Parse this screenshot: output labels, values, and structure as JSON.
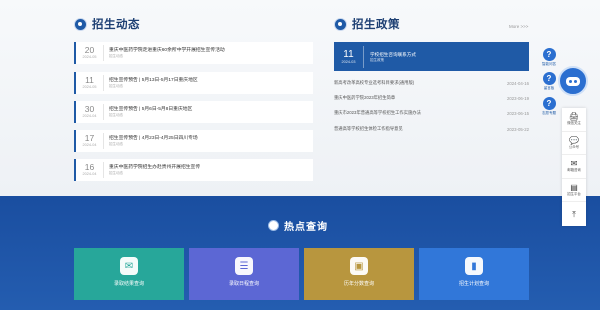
{
  "admissions_news": {
    "title": "招生动态",
    "items": [
      {
        "day": "20",
        "ym": "2024-05",
        "title": "重庆中医药学院走进重庆60余所中学开展招生宣传活动",
        "source": "招生动态"
      },
      {
        "day": "11",
        "ym": "2024-05",
        "title": "招生宣传预告 | 5月13日-5月17日重庆地区",
        "source": "招生动态"
      },
      {
        "day": "30",
        "ym": "2024-04",
        "title": "招生宣传预告 | 5月6日-5月8日重庆地区",
        "source": "招生动态"
      },
      {
        "day": "17",
        "ym": "2024-04",
        "title": "招生宣传预告 | 4月23日-4月25日四川专场",
        "source": "招生动态"
      },
      {
        "day": "16",
        "ym": "2024-04",
        "title": "重庆中医药学院招生办赴贵州开展招生宣传",
        "source": "招生动态"
      }
    ]
  },
  "admissions_policy": {
    "title": "招生政策",
    "more": "More >>>",
    "featured": {
      "day": "11",
      "ym": "2024-03",
      "title": "学校招生咨询联系方式",
      "source": "招生政策"
    },
    "items": [
      {
        "title": "新高考改革高校专业选考科目要求(通用版)",
        "date": "2024-04-16"
      },
      {
        "title": "重庆中医药学院2023年招生简章",
        "date": "2023-06-19"
      },
      {
        "title": "重庆市2023年普通高等学校招生工作实施办法",
        "date": "2023-06-15"
      },
      {
        "title": "普通高等学校招生体检工作指导意见",
        "date": "2023-05-22"
      }
    ]
  },
  "hot_query": {
    "title": "热点查询",
    "cards": [
      {
        "label": "录取结果查询",
        "icon": "envelope-icon",
        "color": "#27a79a"
      },
      {
        "label": "录取日程查询",
        "icon": "list-icon",
        "color": "#5c67d4"
      },
      {
        "label": "历年分数查询",
        "icon": "folder-icon",
        "color": "#b8963e"
      },
      {
        "label": "招生计划查询",
        "icon": "bookmark-icon",
        "color": "#3177d9"
      }
    ]
  },
  "quick_links": [
    {
      "glyph": "?",
      "label": "智能问答"
    },
    {
      "glyph": "?",
      "label": "留言板"
    },
    {
      "glyph": "?",
      "label": "志愿专题"
    }
  ],
  "side_rail": [
    {
      "glyph": "🖨",
      "label": "微信关注",
      "icon": "printer-icon"
    },
    {
      "glyph": "💬",
      "label": "公众号",
      "icon": "chat-icon"
    },
    {
      "glyph": "✉",
      "label": "邮箱咨询",
      "icon": "mail-icon"
    },
    {
      "glyph": "▤",
      "label": "招生平台",
      "icon": "grid-icon"
    },
    {
      "glyph": "⤒",
      "label": "",
      "icon": "back-to-top-icon"
    }
  ]
}
